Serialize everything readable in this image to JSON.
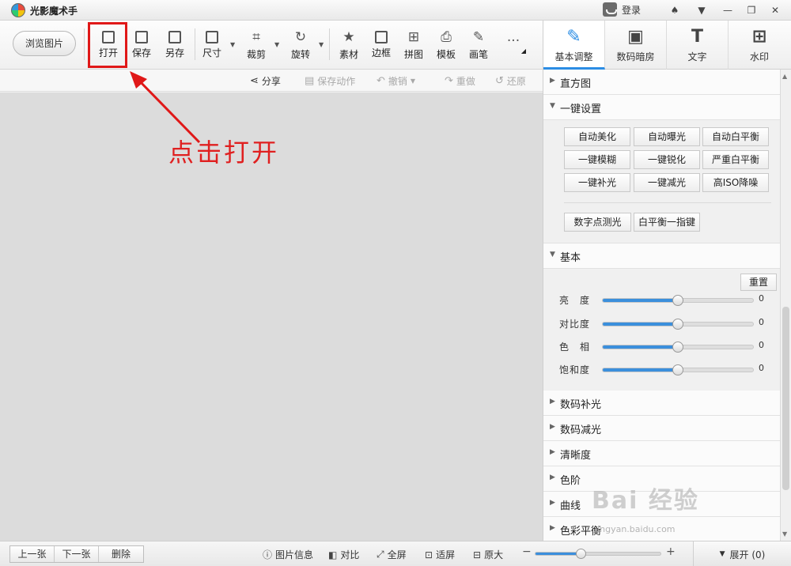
{
  "app": {
    "title": "光影魔术手",
    "login": "登录",
    "logo_icon": "app-logo-icon"
  },
  "window": {
    "controls": [
      "shirt-icon",
      "menu-icon",
      "minimize-icon",
      "maximize-icon",
      "close-icon"
    ]
  },
  "toolbar": {
    "browse": "浏览图片",
    "open": "打开",
    "save": "保存",
    "save_as": "另存",
    "size": "尺寸",
    "crop": "裁剪",
    "rotate": "旋转",
    "material": "素材",
    "border": "边框",
    "collage": "拼图",
    "template": "模板",
    "brush": "画笔",
    "more": "..."
  },
  "actionbar": {
    "share": "分享",
    "save_action": "保存动作",
    "undo": "撤销",
    "redo": "重做",
    "restore": "还原"
  },
  "annotation": {
    "text": "点击打开",
    "color": "#e02020"
  },
  "right_tabs": [
    {
      "label": "基本调整",
      "icon": "edit-icon",
      "glyph": "✎"
    },
    {
      "label": "数码暗房",
      "icon": "camera-icon",
      "glyph": "▣"
    },
    {
      "label": "文字",
      "icon": "text-icon",
      "glyph": "T"
    },
    {
      "label": "水印",
      "icon": "watermark-icon",
      "glyph": "⊞"
    }
  ],
  "panel": {
    "histogram": "直方图",
    "oneclick": {
      "title": "一键设置",
      "buttons": [
        "自动美化",
        "自动曝光",
        "自动白平衡",
        "一键模糊",
        "一键锐化",
        "严重白平衡",
        "一键补光",
        "一键减光",
        "高ISO降噪"
      ],
      "extra": [
        "数字点测光",
        "白平衡一指键"
      ]
    },
    "basic": {
      "title": "基本",
      "reset": "重置",
      "sliders": [
        {
          "label": "亮　度",
          "value": "0",
          "level": 0.5
        },
        {
          "label": "对比度",
          "value": "0",
          "level": 0.5
        },
        {
          "label": "色　相",
          "value": "0",
          "level": 0.5
        },
        {
          "label": "饱和度",
          "value": "0",
          "level": 0.5
        }
      ]
    },
    "sections": [
      "数码补光",
      "数码减光",
      "清晰度",
      "色阶",
      "曲线",
      "色彩平衡"
    ]
  },
  "statusbar": {
    "prev": "上一张",
    "next": "下一张",
    "delete": "删除",
    "info": "图片信息",
    "compare": "对比",
    "fullscreen": "全屏",
    "fit": "适屏",
    "original": "原大",
    "zoom_level": 0.36,
    "minus": "−",
    "plus": "+",
    "expand": "展开 (0)"
  },
  "watermark": {
    "brand": "Bai 经验",
    "url": "jingyan.baidu.com"
  },
  "colors": {
    "accent": "#2b8de4",
    "highlight": "#e01818"
  }
}
